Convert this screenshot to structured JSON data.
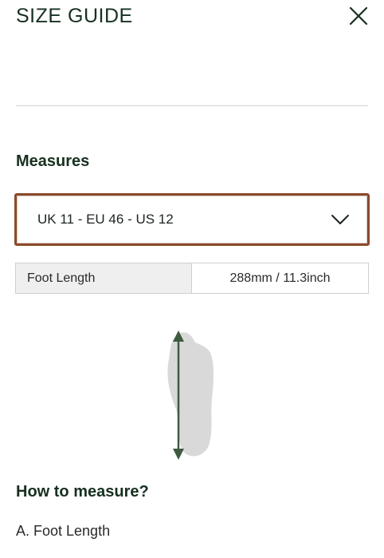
{
  "header": {
    "title": "SIZE GUIDE",
    "close_icon": "close-icon"
  },
  "measures": {
    "heading": "Measures",
    "selected_size": "UK 11 - EU 46 - US 12",
    "dropdown_icon": "chevron-down-icon",
    "focus_border_color": "#8b4a2b"
  },
  "table": {
    "label": "Foot Length",
    "value": "288mm / 11.3inch"
  },
  "illustration": {
    "icon": "foot-length-diagram-icon",
    "arrow_color": "#3e5a3f",
    "foot_color": "#d9d9d9"
  },
  "how_to": {
    "heading": "How to measure?",
    "step_a": "A. Foot Length"
  }
}
